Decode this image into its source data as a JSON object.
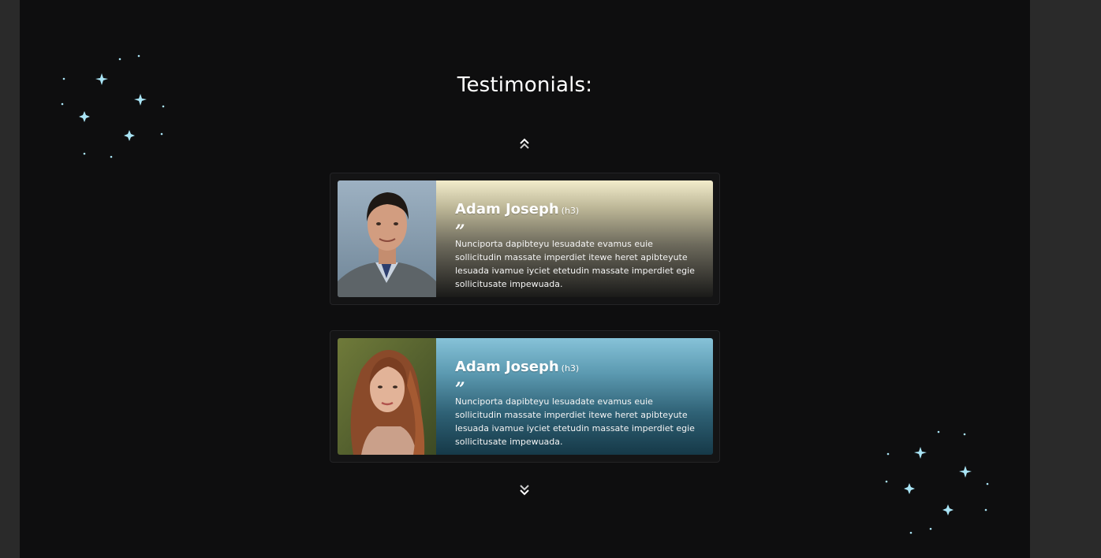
{
  "section": {
    "title": "Testimonials:"
  },
  "controls": {
    "up_icon": "double-chevron-up-icon",
    "down_icon": "double-chevron-down-icon"
  },
  "testimonials": [
    {
      "name": "Adam Joseph",
      "tag": "(h3)",
      "quote_mark": "”",
      "text": "Nunciporta dapibteyu lesuadate evamus euie sollicitudin massate imperdiet itewe heret apibteyute lesuada ivamue iyciet etetudin massate imperdiet egie sollicitusate impewuada.",
      "theme_color": "#f2eccb"
    },
    {
      "name": "Adam Joseph",
      "tag": "(h3)",
      "quote_mark": "”",
      "text": "Nunciporta dapibteyu lesuadate evamus euie sollicitudin massate imperdiet itewe heret apibteyute lesuada ivamue iyciet etetudin massate imperdiet egie sollicitusate impewuada.",
      "theme_color": "#86c2d8"
    }
  ],
  "colors": {
    "background": "#0e0e0f",
    "sparkle": "#a9e4f5"
  }
}
